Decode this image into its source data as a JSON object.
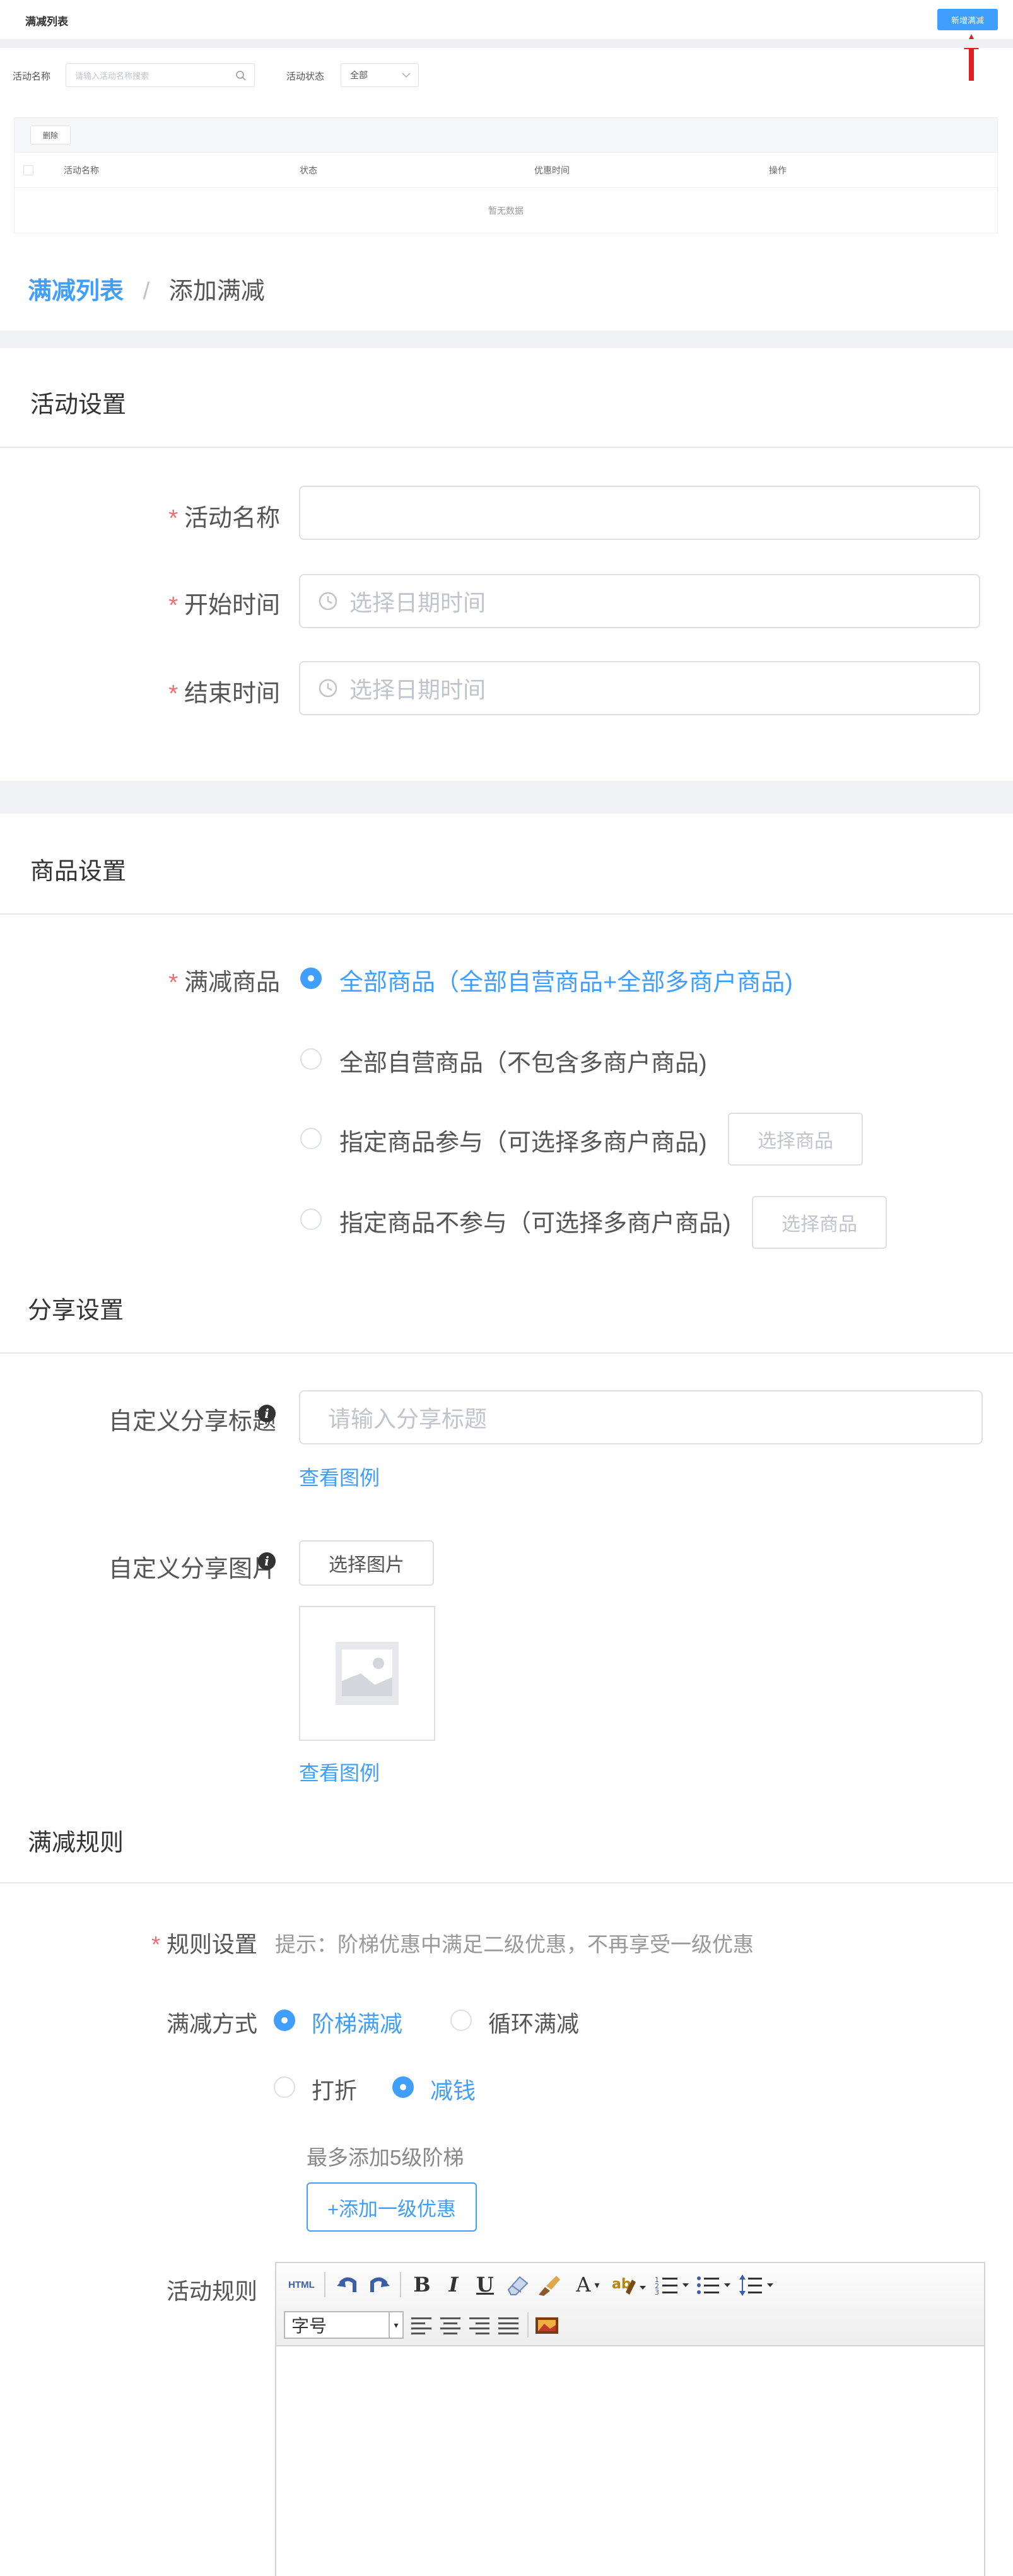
{
  "topbar": {
    "title": "满减列表",
    "add_button": "新增满减"
  },
  "filter": {
    "name_label": "活动名称",
    "name_placeholder": "请输入活动名称搜索",
    "status_label": "活动状态",
    "status_value": "全部"
  },
  "table": {
    "delete_button": "删除",
    "columns": [
      "活动名称",
      "状态",
      "优惠时间",
      "操作"
    ],
    "empty_text": "暂无数据"
  },
  "breadcrumb": {
    "parent": "满减列表",
    "separator": "/",
    "current": "添加满减"
  },
  "activity_settings": {
    "title": "活动设置",
    "fields": [
      {
        "label": "活动名称",
        "placeholder": ""
      },
      {
        "label": "开始时间",
        "placeholder": "选择日期时间"
      },
      {
        "label": "结束时间",
        "placeholder": "选择日期时间"
      }
    ],
    "required_mark": "*"
  },
  "goods_settings": {
    "title": "商品设置",
    "label": "满减商品",
    "options": [
      {
        "text": "全部商品（全部自营商品+全部多商户商品)",
        "selected": true
      },
      {
        "text": "全部自营商品（不包含多商户商品)",
        "selected": false
      },
      {
        "text": "指定商品参与（可选择多商户商品)",
        "selected": false
      },
      {
        "text": "指定商品不参与（可选择多商户商品)",
        "selected": false
      }
    ],
    "select_goods_button": "选择商品"
  },
  "share_settings": {
    "title": "分享设置",
    "share_title_label": "自定义分享标题",
    "share_title_placeholder": "请输入分享标题",
    "view_example": "查看图例",
    "share_image_label": "自定义分享图片",
    "select_image_button": "选择图片"
  },
  "rules": {
    "title": "满减规则",
    "rule_label": "规则设置",
    "hint": "提示：阶梯优惠中满足二级优惠，不再享受一级优惠",
    "mode_label": "满减方式",
    "mode_options": [
      {
        "text": "阶梯满减",
        "selected": true
      },
      {
        "text": "循环满减",
        "selected": false
      }
    ],
    "type_options": [
      {
        "text": "打折",
        "selected": false
      },
      {
        "text": "减钱",
        "selected": true
      }
    ],
    "max_tip": "最多添加5级阶梯",
    "add_level_button": "+添加一级优惠",
    "activity_rule_label": "活动规则",
    "editor": {
      "html_label": "HTML",
      "font_size_label": "字号"
    }
  },
  "colors": {
    "accent": "#409eff",
    "required": "#f56c6c",
    "arrow": "#e02020"
  }
}
